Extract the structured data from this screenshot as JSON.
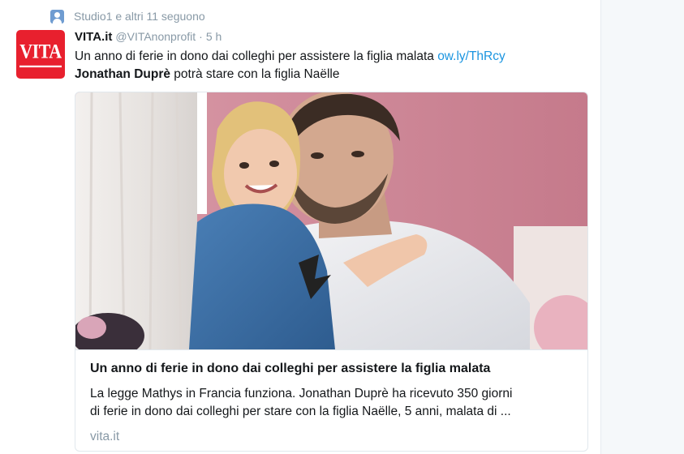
{
  "context": {
    "icon": "person-icon",
    "text": "Studio1 e altri 11 seguono"
  },
  "tweet": {
    "avatar": {
      "logo_text": "VITA",
      "color": "#e8202e"
    },
    "author_name": "VITA.it",
    "author_handle": "@VITAnonprofit",
    "separator": "·",
    "time": "5 h",
    "text_line1": "Un anno di ferie in dono dai colleghi per assistere la figlia malata",
    "link": "ow.ly/ThRcy",
    "text_line2_bold": "Jonathan Duprè",
    "text_line2_rest": "potrà stare con la figlia Naëlle"
  },
  "card": {
    "title": "Un anno di ferie in dono dai colleghi per assistere la figlia malata",
    "description_line1": "La legge Mathys in Francia funziona. Jonathan Duprè ha ricevuto 350 giorni",
    "description_line2": "di ferie in dono dai colleghi per stare con la figlia Naëlle, 5 anni, malata di ...",
    "domain": "vita.it"
  },
  "colors": {
    "link": "#1b95e0",
    "muted": "#8899a6",
    "text": "#14171a",
    "border": "#e1e8ed"
  }
}
